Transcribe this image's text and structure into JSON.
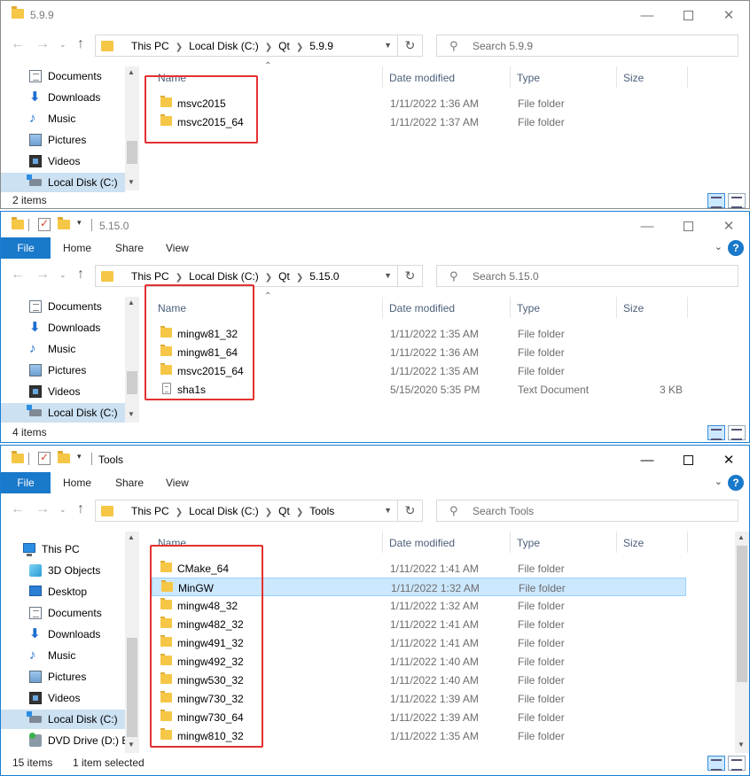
{
  "nav_buttons": {
    "back": "←",
    "forward": "→",
    "up": "↑",
    "dropdown": "⌄"
  },
  "window_controls": {
    "minimize": "—",
    "close": "✕"
  },
  "ribbon_tabs": [
    "File",
    "Home",
    "Share",
    "View"
  ],
  "ribbon_help": "?",
  "ribbon_collapse": "⌄",
  "columns": {
    "name": "Name",
    "date": "Date modified",
    "type": "Type",
    "size": "Size"
  },
  "windows": [
    {
      "title": "5.9.9",
      "breadcrumb": [
        "This PC",
        "Local Disk (C:)",
        "Qt",
        "5.9.9"
      ],
      "search_placeholder": "Search 5.9.9",
      "nav_items": [
        "Documents",
        "Downloads",
        "Music",
        "Pictures",
        "Videos",
        "Local Disk (C:)"
      ],
      "files": [
        {
          "name": "msvc2015",
          "date": "1/11/2022 1:36 AM",
          "type": "File folder",
          "size": ""
        },
        {
          "name": "msvc2015_64",
          "date": "1/11/2022 1:37 AM",
          "type": "File folder",
          "size": ""
        }
      ],
      "status": "2 items",
      "status_selected": ""
    },
    {
      "title": "5.15.0",
      "breadcrumb": [
        "This PC",
        "Local Disk (C:)",
        "Qt",
        "5.15.0"
      ],
      "search_placeholder": "Search 5.15.0",
      "nav_items": [
        "Documents",
        "Downloads",
        "Music",
        "Pictures",
        "Videos",
        "Local Disk (C:)"
      ],
      "files": [
        {
          "name": "mingw81_32",
          "date": "1/11/2022 1:35 AM",
          "type": "File folder",
          "size": ""
        },
        {
          "name": "mingw81_64",
          "date": "1/11/2022 1:36 AM",
          "type": "File folder",
          "size": ""
        },
        {
          "name": "msvc2015_64",
          "date": "1/11/2022 1:35 AM",
          "type": "File folder",
          "size": ""
        },
        {
          "name": "sha1s",
          "date": "5/15/2020 5:35 PM",
          "type": "Text Document",
          "size": "3 KB"
        }
      ],
      "status": "4 items",
      "status_selected": ""
    },
    {
      "title": "Tools",
      "breadcrumb": [
        "This PC",
        "Local Disk (C:)",
        "Qt",
        "Tools"
      ],
      "search_placeholder": "Search Tools",
      "nav_items": [
        "This PC",
        "3D Objects",
        "Desktop",
        "Documents",
        "Downloads",
        "Music",
        "Pictures",
        "Videos",
        "Local Disk (C:)",
        "DVD Drive (D:) ES"
      ],
      "files": [
        {
          "name": "CMake_64",
          "date": "1/11/2022 1:41 AM",
          "type": "File folder",
          "size": ""
        },
        {
          "name": "MinGW",
          "date": "1/11/2022 1:32 AM",
          "type": "File folder",
          "size": "",
          "selected": true
        },
        {
          "name": "mingw48_32",
          "date": "1/11/2022 1:32 AM",
          "type": "File folder",
          "size": ""
        },
        {
          "name": "mingw482_32",
          "date": "1/11/2022 1:41 AM",
          "type": "File folder",
          "size": ""
        },
        {
          "name": "mingw491_32",
          "date": "1/11/2022 1:41 AM",
          "type": "File folder",
          "size": ""
        },
        {
          "name": "mingw492_32",
          "date": "1/11/2022 1:40 AM",
          "type": "File folder",
          "size": ""
        },
        {
          "name": "mingw530_32",
          "date": "1/11/2022 1:40 AM",
          "type": "File folder",
          "size": ""
        },
        {
          "name": "mingw730_32",
          "date": "1/11/2022 1:39 AM",
          "type": "File folder",
          "size": ""
        },
        {
          "name": "mingw730_64",
          "date": "1/11/2022 1:39 AM",
          "type": "File folder",
          "size": ""
        },
        {
          "name": "mingw810_32",
          "date": "1/11/2022 1:35 AM",
          "type": "File folder",
          "size": ""
        }
      ],
      "status": "15 items",
      "status_selected": "1 item selected"
    }
  ]
}
